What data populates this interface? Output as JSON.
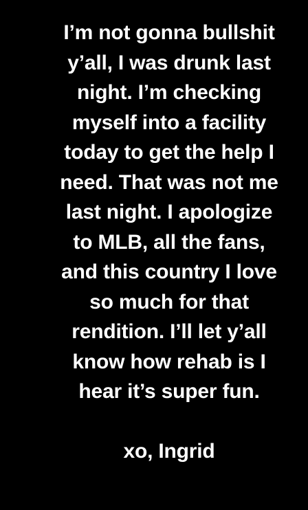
{
  "background_color": "#000000",
  "text_color": "#ffffff",
  "statement": {
    "lines": [
      "I’m not gonna bullshit",
      "y’all, I was drunk last",
      "night. I’m checking",
      "myself into a facility",
      "today to get the help I",
      "need. That was not me",
      "last night. I apologize",
      "to MLB, all the fans,",
      "and this country I love",
      "so much for that",
      "rendition. I’ll let y’all",
      "know how rehab is I",
      "hear it’s super fun."
    ],
    "signoff": "xo, Ingrid"
  }
}
